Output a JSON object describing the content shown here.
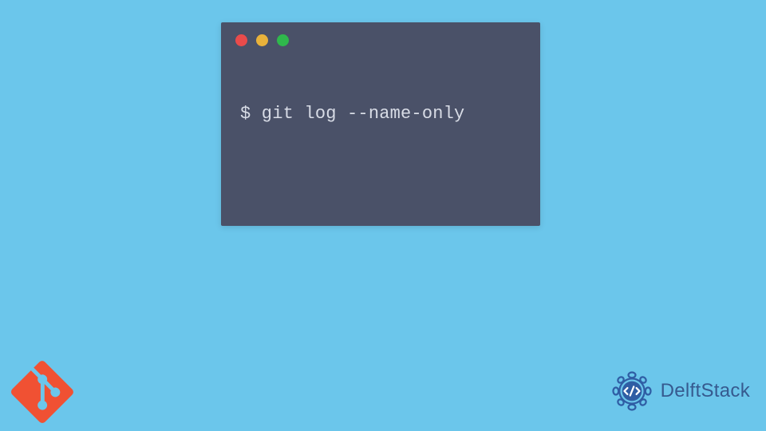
{
  "terminal": {
    "command_line": "$ git log --name-only",
    "window_controls": {
      "close_color": "#e94b4b",
      "minimize_color": "#e9b23b",
      "zoom_color": "#2fb84c"
    }
  },
  "brand": {
    "name": "DelftStack"
  },
  "bottom_left_logo": {
    "name": "git"
  }
}
